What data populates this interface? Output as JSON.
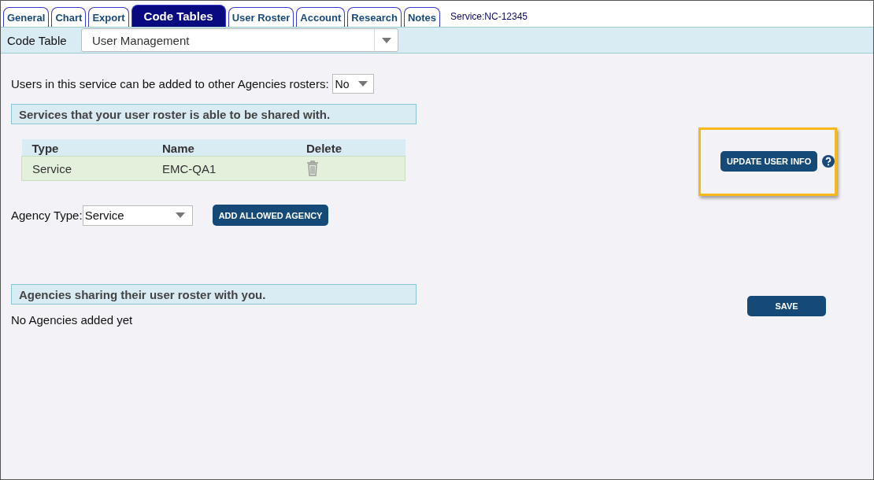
{
  "tabs": [
    {
      "label": "General",
      "selected": false
    },
    {
      "label": "Chart",
      "selected": false
    },
    {
      "label": "Export",
      "selected": false
    },
    {
      "label": "Code Tables",
      "selected": true
    },
    {
      "label": "User Roster",
      "selected": false
    },
    {
      "label": "Account",
      "selected": false
    },
    {
      "label": "Research",
      "selected": false
    },
    {
      "label": "Notes",
      "selected": false
    }
  ],
  "service_label": "Service:NC-12345",
  "code_table": {
    "label": "Code Table",
    "value": "User Management"
  },
  "share_setting": {
    "label": "Users in this service can be added to other Agencies rosters:",
    "value": "No"
  },
  "shared_with": {
    "heading": "Services that your user roster is able to be shared with.",
    "columns": [
      "Type",
      "Name",
      "Delete"
    ],
    "rows": [
      {
        "type": "Service",
        "name": "EMC-QA1"
      }
    ]
  },
  "agency_type": {
    "label": "Agency Type:",
    "value": "Service"
  },
  "add_button": "ADD ALLOWED AGENCY",
  "sharing_with_you": {
    "heading": "Agencies sharing their user roster with you.",
    "empty_text": "No Agencies added yet"
  },
  "update_button": {
    "label": "UPDATE USER INFO",
    "highlighted": true
  },
  "save_button": "SAVE"
}
